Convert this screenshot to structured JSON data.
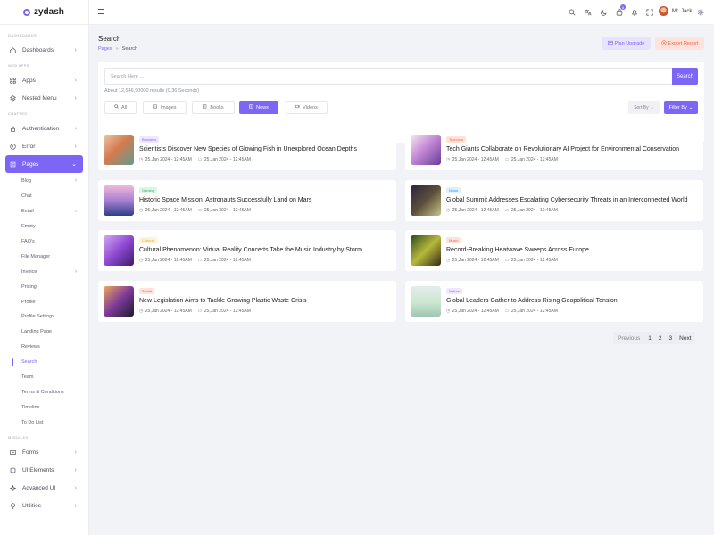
{
  "app": {
    "name": "zydash"
  },
  "sidebar": {
    "sections": {
      "dashboards": "DASHBOARDS",
      "web_apps": "WEB APPS",
      "crafted": "CRAFTED",
      "modules": "MODULES"
    },
    "items": {
      "dashboards": "Dashboards",
      "apps": "Apps",
      "nested_menu": "Nested Menu",
      "authentication": "Authentication",
      "error": "Error",
      "pages": "Pages",
      "forms": "Forms",
      "ui_elements": "UI Elements",
      "advanced_ui": "Advanced UI",
      "utilities": "Utilities"
    },
    "pages_sub": [
      {
        "label": "Blog",
        "chev": true
      },
      {
        "label": "Chat"
      },
      {
        "label": "Email",
        "chev": true
      },
      {
        "label": "Empty"
      },
      {
        "label": "FAQ's"
      },
      {
        "label": "File Manager"
      },
      {
        "label": "Invoice",
        "chev": true
      },
      {
        "label": "Pricing"
      },
      {
        "label": "Profile"
      },
      {
        "label": "Profile Settings"
      },
      {
        "label": "Landing Page"
      },
      {
        "label": "Reviews"
      },
      {
        "label": "Search",
        "active": true
      },
      {
        "label": "Team"
      },
      {
        "label": "Terms & Conditions"
      },
      {
        "label": "Timeline"
      },
      {
        "label": "To Do List"
      }
    ]
  },
  "header": {
    "user_name": "Mr. Jack",
    "cart_count": "5"
  },
  "page": {
    "title": "Search",
    "breadcrumb": {
      "parent": "Pages",
      "separator": "»",
      "current": "Search"
    },
    "plan_upgrade": "Plan Upgrade",
    "export_report": "Export Report"
  },
  "search": {
    "placeholder": "Search Here ...",
    "button": "Search",
    "results_text": "About 12,546,90000 results (0.36 Seconds)",
    "tabs": {
      "all": "All",
      "images": "Images",
      "books": "Books",
      "news": "News",
      "videos": "Videos"
    },
    "sort_by": "Sort By",
    "filter_by": "Filter By"
  },
  "news": [
    {
      "tag": "Business",
      "title": "Scientists Discover New Species of Glowing Fish in Unexplored Ocean Depths",
      "date1": "25,Jan 2024 - 12:45AM",
      "date2": "25,Jan 2024 - 12:45AM"
    },
    {
      "tag": "Technolo",
      "title": "Tech Giants Collaborate on Revolutionary AI Project for Environmental Conservation",
      "date1": "25,Jan 2024 - 12:45AM",
      "date2": "25,Jan 2024 - 12:45AM"
    },
    {
      "tag": "Gaming",
      "title": "Historic Space Mission: Astronauts Successfully Land on Mars",
      "date1": "25,Jan 2024 - 12:45AM",
      "date2": "25,Jan 2024 - 12:45AM"
    },
    {
      "tag": "News",
      "title": "Global Summit Addresses Escalating Cybersecurity Threats in an Interconnected World",
      "date1": "25,Jan 2024 - 12:45AM",
      "date2": "25,Jan 2024 - 12:45AM"
    },
    {
      "tag": "Cultural",
      "title": "Cultural Phenomenon: Virtual Reality Concerts Take the Music Industry by Storm",
      "date1": "25,Jan 2024 - 12:45AM",
      "date2": "25,Jan 2024 - 12:45AM"
    },
    {
      "tag": "Music",
      "title": "Record-Breaking Heatwave Sweeps Across Europe",
      "date1": "25,Jan 2024 - 12:45AM",
      "date2": "25,Jan 2024 - 12:45AM"
    },
    {
      "tag": "Social",
      "title": "New Legislation Aims to Tackle Growing Plastic Waste Crisis",
      "date1": "25,Jan 2024 - 12:45AM",
      "date2": "25,Jan 2024 - 12:45AM"
    },
    {
      "tag": "Nature",
      "title": "Global Leaders Gather to Address Rising Geopolitical Tension",
      "date1": "25,Jan 2024 - 12:45AM",
      "date2": "25,Jan 2024 - 12:45AM"
    }
  ],
  "pagination": {
    "previous": "Previous",
    "pages": [
      "1",
      "2",
      "3"
    ],
    "next": "Next"
  },
  "colors": {
    "accent": "#7d66f5",
    "danger": "#ee6a4c"
  }
}
